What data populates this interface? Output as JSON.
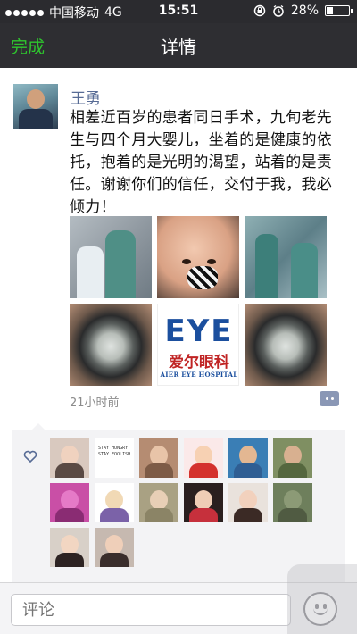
{
  "status_bar": {
    "carrier": "中国移动",
    "network": "4G",
    "time": "15:51",
    "battery": "28%",
    "battery_level": 0.28
  },
  "nav": {
    "done_label": "完成",
    "title": "详情"
  },
  "post": {
    "author": "王勇",
    "text": "相差近百岁的患者同日手术，九旬老先生与四个月大婴儿，坐着的是健康的依托，抱着的是光明的渴望，站着的是责任。谢谢你们的信任，交付于我，我必倾力！",
    "timestamp": "21小时前",
    "logo": {
      "eye": "EYE",
      "cn": "爱尔眼科",
      "en": "AIER EYE HOSPITAL"
    }
  },
  "likes": {
    "text_avatar": "STAY HUNGRY STAY FOOLISH"
  },
  "comment_bar": {
    "placeholder": "评论"
  },
  "colors": {
    "nav_bg": "#2e2e32",
    "done_green": "#2ec52e",
    "author_blue": "#576b95",
    "comment_icon": "#8a97b5"
  }
}
